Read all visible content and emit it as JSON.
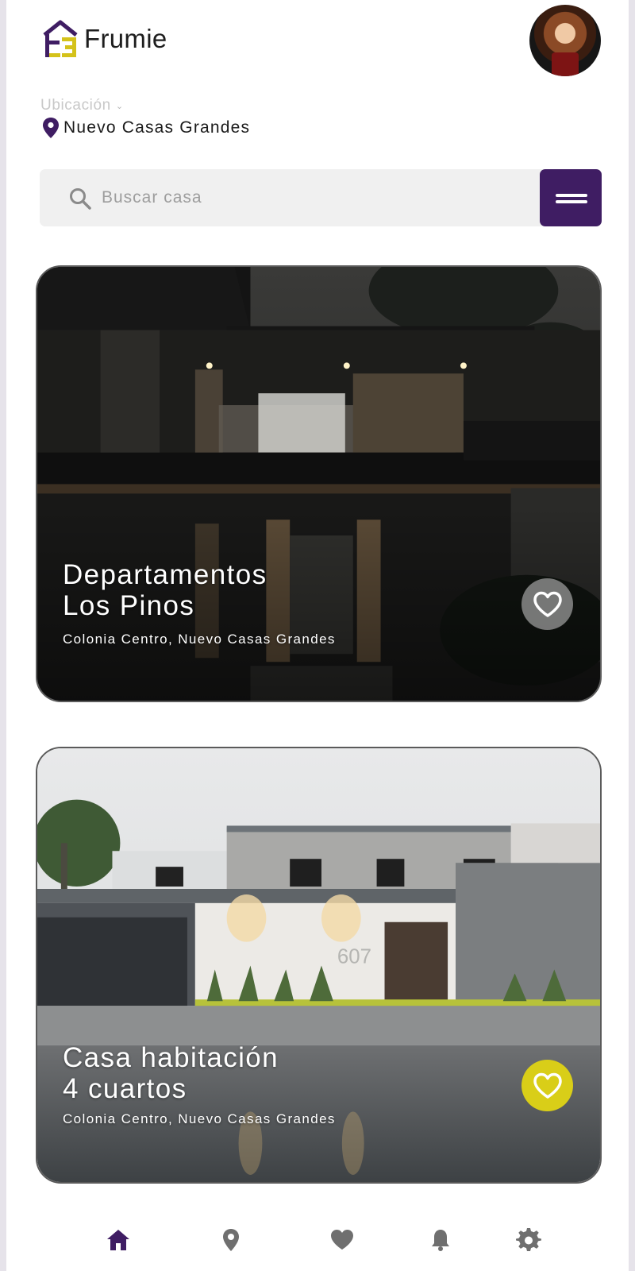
{
  "app": {
    "name": "Frumie",
    "logo_text": "FE",
    "accent_color": "#3f1d63",
    "highlight_color": "#d9ce18"
  },
  "header": {
    "avatar": "user-avatar"
  },
  "location": {
    "label": "Ubicación",
    "value": "Nuevo Casas Grandes",
    "icon": "location-pin-icon"
  },
  "search": {
    "placeholder": "Buscar casa",
    "value": "",
    "icon": "search-icon",
    "filter_icon": "menu-lines-icon"
  },
  "listings": [
    {
      "title": "Departamentos\nLos Pinos",
      "subtitle": "Colonia Centro, Nuevo Casas Grandes",
      "favorited": false
    },
    {
      "title": "Casa habitación\n4 cuartos",
      "subtitle": "Colonia Centro, Nuevo Casas Grandes",
      "favorited": true,
      "house_number": "607"
    }
  ],
  "nav": {
    "items": [
      {
        "icon": "home-icon",
        "active": true
      },
      {
        "icon": "map-pin-icon",
        "active": false
      },
      {
        "icon": "heart-icon",
        "active": false
      },
      {
        "icon": "bell-icon",
        "active": false
      },
      {
        "icon": "gear-icon",
        "active": false
      }
    ],
    "active_color": "#3f1d63",
    "inactive_color": "#6f6f6f"
  }
}
